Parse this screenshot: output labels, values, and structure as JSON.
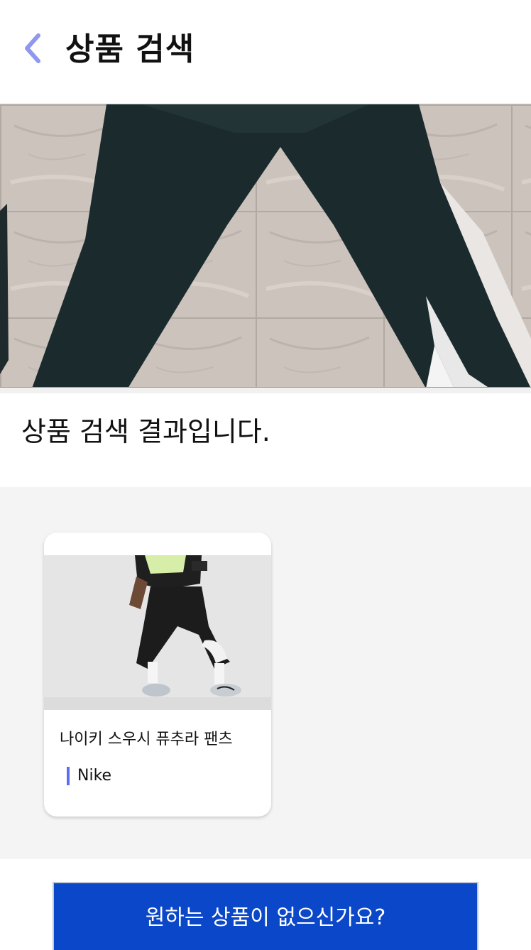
{
  "header": {
    "back_icon": "chevron-left-icon",
    "title": "상품 검색"
  },
  "search_photo": {
    "description_icon": "uploaded-photo"
  },
  "results": {
    "heading": "상품 검색 결과입니다.",
    "items": [
      {
        "name": "나이키 스우시 퓨추라 팬츠",
        "brand": "Nike"
      }
    ]
  },
  "cta": {
    "label": "원하는 상품이 없으신가요?"
  },
  "colors": {
    "accent": "#8f97ee",
    "brand_bar": "#5d6ef2",
    "cta_background": "#0b47c9",
    "results_background": "#f4f4f4"
  }
}
